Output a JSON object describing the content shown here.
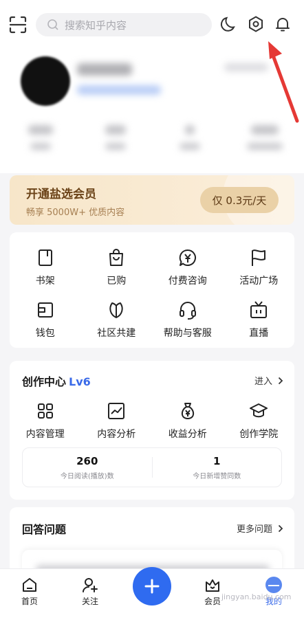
{
  "search": {
    "placeholder": "搜索知乎内容"
  },
  "top_icons": [
    "scan-icon",
    "moon-icon",
    "settings-hexagon-icon",
    "bell-icon"
  ],
  "vip": {
    "title": "开通盐选会员",
    "subtitle": "畅享 5000W+ 优质内容",
    "button": "仅 0.3元/天"
  },
  "shortcuts": [
    {
      "label": "书架",
      "icon": "bookshelf-icon"
    },
    {
      "label": "已购",
      "icon": "shopping-bag-icon"
    },
    {
      "label": "付费咨询",
      "icon": "paid-consult-icon"
    },
    {
      "label": "活动广场",
      "icon": "flag-icon"
    },
    {
      "label": "钱包",
      "icon": "wallet-icon"
    },
    {
      "label": "社区共建",
      "icon": "leaf-icon"
    },
    {
      "label": "帮助与客服",
      "icon": "headset-icon"
    },
    {
      "label": "直播",
      "icon": "tv-icon"
    }
  ],
  "creation": {
    "title": "创作中心",
    "level": "Lv6",
    "enter": "进入",
    "tools": [
      {
        "label": "内容管理",
        "icon": "grid-icon"
      },
      {
        "label": "内容分析",
        "icon": "chart-icon"
      },
      {
        "label": "收益分析",
        "icon": "money-bag-icon"
      },
      {
        "label": "创作学院",
        "icon": "graduation-cap-icon"
      }
    ],
    "stats": [
      {
        "value": "260",
        "label": "今日阅读(播放)数"
      },
      {
        "value": "1",
        "label": "今日新增赞同数"
      }
    ]
  },
  "questions": {
    "title": "回答问题",
    "more": "更多问题"
  },
  "bottom_nav": [
    {
      "label": "首页",
      "icon": "home-icon"
    },
    {
      "label": "关注",
      "icon": "follow-icon"
    },
    {
      "label": "",
      "icon": "plus-icon"
    },
    {
      "label": "会员",
      "icon": "vip-crown-icon"
    },
    {
      "label": "我的",
      "icon": "avatar-icon"
    }
  ],
  "watermark": "jingyan.baidu.com",
  "colors": {
    "accent": "#2f6bf0",
    "vip_text": "#6b4318",
    "level": "#3a6ae8",
    "arrow": "#e53935"
  }
}
